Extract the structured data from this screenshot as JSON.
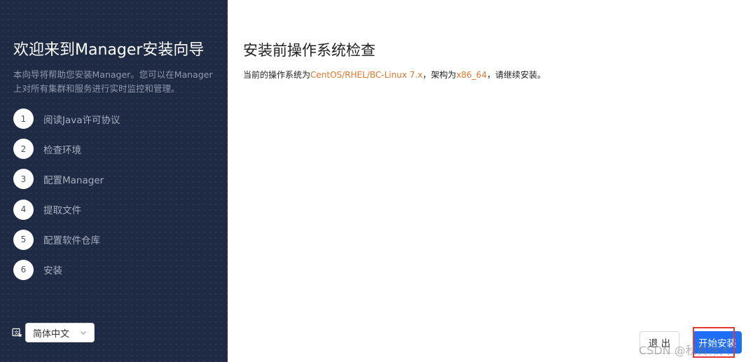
{
  "sidebar": {
    "title": "欢迎来到Manager安装向导",
    "description": "本向导将帮助您安装Manager。您可以在Manager上对所有集群和服务进行实时监控和管理。",
    "steps": [
      {
        "num": "1",
        "label": "阅读Java许可协议"
      },
      {
        "num": "2",
        "label": "检查环境"
      },
      {
        "num": "3",
        "label": "配置Manager"
      },
      {
        "num": "4",
        "label": "提取文件"
      },
      {
        "num": "5",
        "label": "配置软件仓库"
      },
      {
        "num": "6",
        "label": "安装"
      }
    ],
    "language": {
      "icon": "language-icon",
      "selected": "简体中文"
    }
  },
  "main": {
    "title": "安装前操作系统检查",
    "check": {
      "prefix": "当前的操作系统为",
      "os": "CentOS/RHEL/BC-Linux 7.x",
      "mid": "，架构为",
      "arch": "x86_64",
      "suffix": "，请继续安装。"
    }
  },
  "footer": {
    "exit_label": "退 出",
    "start_label": "开始安装"
  },
  "watermark": "CSDN @秋真伟大",
  "colors": {
    "sidebar_bg": "#1f2a44",
    "highlight_text": "#e0772e",
    "primary_button": "#1e6ff5",
    "annotation_box": "#e53935"
  }
}
